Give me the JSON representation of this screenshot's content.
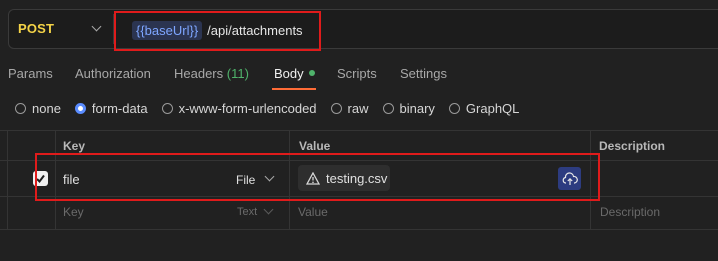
{
  "request": {
    "method": "POST",
    "url_variable": "{{baseUrl}}",
    "url_path": "/api/attachments"
  },
  "tabs": [
    {
      "label": "Params"
    },
    {
      "label": "Authorization"
    },
    {
      "label": "Headers",
      "count": "(11)"
    },
    {
      "label": "Body",
      "active": true
    },
    {
      "label": "Scripts"
    },
    {
      "label": "Settings"
    }
  ],
  "body_types": [
    {
      "label": "none",
      "selected": false
    },
    {
      "label": "form-data",
      "selected": true
    },
    {
      "label": "x-www-form-urlencoded",
      "selected": false
    },
    {
      "label": "raw",
      "selected": false
    },
    {
      "label": "binary",
      "selected": false
    },
    {
      "label": "GraphQL",
      "selected": false
    }
  ],
  "table": {
    "headers": {
      "key": "Key",
      "value": "Value",
      "description": "Description"
    },
    "rows": [
      {
        "checked": true,
        "key": "file",
        "type": "File",
        "value": "testing.csv",
        "description": ""
      }
    ],
    "placeholder_row": {
      "key": "Key",
      "type": "Text",
      "value": "Value",
      "description": "Description"
    }
  },
  "colors": {
    "method": "#f4d347",
    "variable": "#7ea6ff",
    "active_tab_indicator": "#ff6c37",
    "body_dot": "#4fb36b",
    "radio_selected": "#5a8cff",
    "annotation_box": "#e01b1b",
    "upload_button": "#2d3c80"
  },
  "icons": {
    "method_dropdown": "chevron-down-icon",
    "warning": "warning-icon",
    "upload": "cloud-upload-icon",
    "checkbox": "checkmark-icon"
  }
}
